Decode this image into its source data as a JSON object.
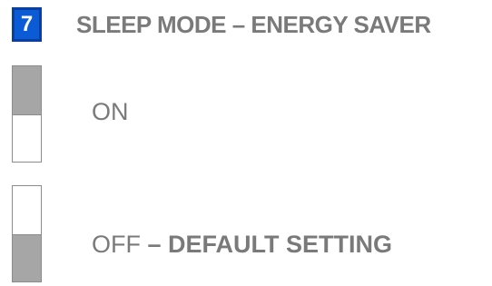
{
  "header": {
    "step_number": "7",
    "title": "SLEEP MODE – ENERGY SAVER"
  },
  "options": [
    {
      "state_label": "ON",
      "suffix": "",
      "switch_position": "up"
    },
    {
      "state_label": "OFF",
      "suffix": " – DEFAULT SETTING",
      "switch_position": "down"
    }
  ],
  "colors": {
    "badge_bg": "#0b5ad6",
    "text": "#7a7a7a",
    "switch_fill": "#a6a6a6"
  }
}
